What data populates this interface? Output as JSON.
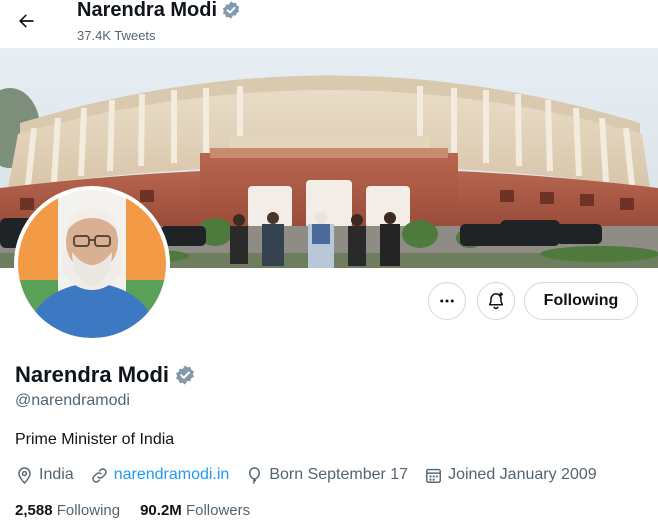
{
  "header": {
    "title": "Narendra Modi",
    "tweets_count": "37.4K Tweets"
  },
  "profile": {
    "name": "Narendra Modi",
    "handle": "@narendramodi",
    "bio": "Prime Minister of India",
    "location": "India",
    "website": "narendramodi.in",
    "born": "Born September 17",
    "joined": "Joined January 2009",
    "following_count": "2,588",
    "following_label": "Following",
    "followers_count": "90.2M",
    "followers_label": "Followers"
  },
  "actions": {
    "follow_label": "Following",
    "more_icon": "more-icon",
    "notify_icon": "bell-plus-icon"
  },
  "colors": {
    "link": "#1d9bf0",
    "verified": "#829aab",
    "secondary_text": "#536471"
  }
}
